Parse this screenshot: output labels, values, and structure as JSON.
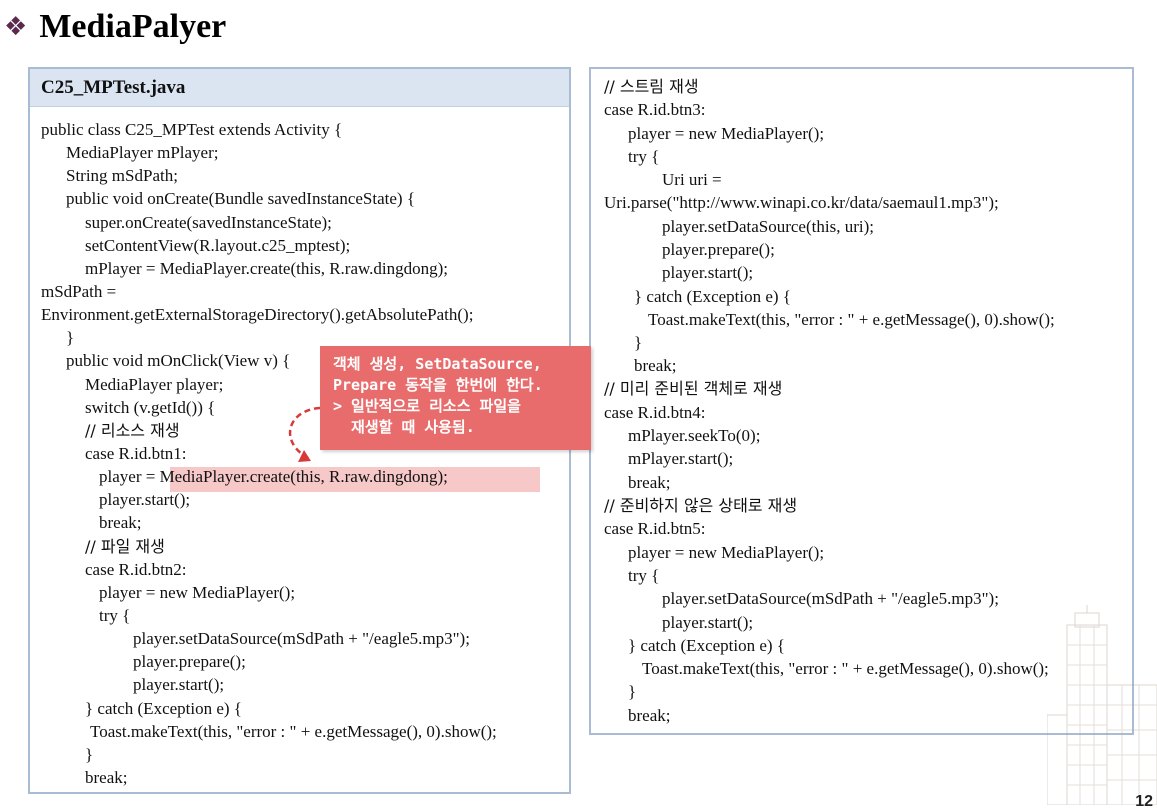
{
  "slide": {
    "bullet": "❖",
    "title": "MediaPalyer",
    "page_number": "12"
  },
  "left_panel": {
    "header": "C25_MPTest.java",
    "lines": [
      "public class C25_MPTest extends Activity {",
      "MediaPlayer mPlayer;",
      "String mSdPath;",
      "public void onCreate(Bundle savedInstanceState) {",
      "super.onCreate(savedInstanceState);",
      "setContentView(R.layout.c25_mptest);",
      "mPlayer = MediaPlayer.create(this, R.raw.dingdong);",
      "mSdPath =",
      "Environment.getExternalStorageDirectory().getAbsolutePath();",
      "}",
      "public void mOnClick(View v) {",
      "MediaPlayer player;",
      "switch (v.getId()) {",
      "// 리소스 재생",
      "case R.id.btn1:",
      "player = MediaPlayer.create(this, R.raw.dingdong);",
      "player.start();",
      "break;",
      "// 파일 재생",
      "case R.id.btn2:",
      "player = new MediaPlayer();",
      "try {",
      "player.setDataSource(mSdPath + \"/eagle5.mp3\");",
      "player.prepare();",
      "player.start();",
      "} catch (Exception e) {",
      "Toast.makeText(this, \"error : \" + e.getMessage(), 0).show();",
      "}",
      "break;"
    ]
  },
  "right_panel": {
    "lines": [
      "// 스트림 재생",
      "case R.id.btn3:",
      "player = new MediaPlayer();",
      "try {",
      "Uri uri =",
      "Uri.parse(\"http://www.winapi.co.kr/data/saemaul1.mp3\");",
      "player.setDataSource(this, uri);",
      "player.prepare();",
      "player.start();",
      "} catch (Exception e) {",
      "Toast.makeText(this, \"error : \" + e.getMessage(), 0).show();",
      "}",
      "break;",
      "// 미리 준비된 객체로 재생",
      "case R.id.btn4:",
      "mPlayer.seekTo(0);",
      "mPlayer.start();",
      "break;",
      "// 준비하지 않은 상태로 재생",
      "case R.id.btn5:",
      "player = new MediaPlayer();",
      "try {",
      "player.setDataSource(mSdPath + \"/eagle5.mp3\");",
      "player.start();",
      "} catch (Exception e) {",
      "Toast.makeText(this, \"error : \" + e.getMessage(), 0).show();",
      "}",
      "break;"
    ]
  },
  "callout": {
    "lines": [
      "객체 생성, SetDataSource,",
      "Prepare 동작을 한번에 한다.",
      "> 일반적으로 리소스 파일을",
      "  재생할 때 사용됨."
    ]
  },
  "colors": {
    "panel_border": "#a9bcd3",
    "header_bg": "#dbe5f1",
    "callout_bg": "#e86c6c",
    "highlight": "#f3b5b5",
    "arrow": "#d83a3a"
  }
}
